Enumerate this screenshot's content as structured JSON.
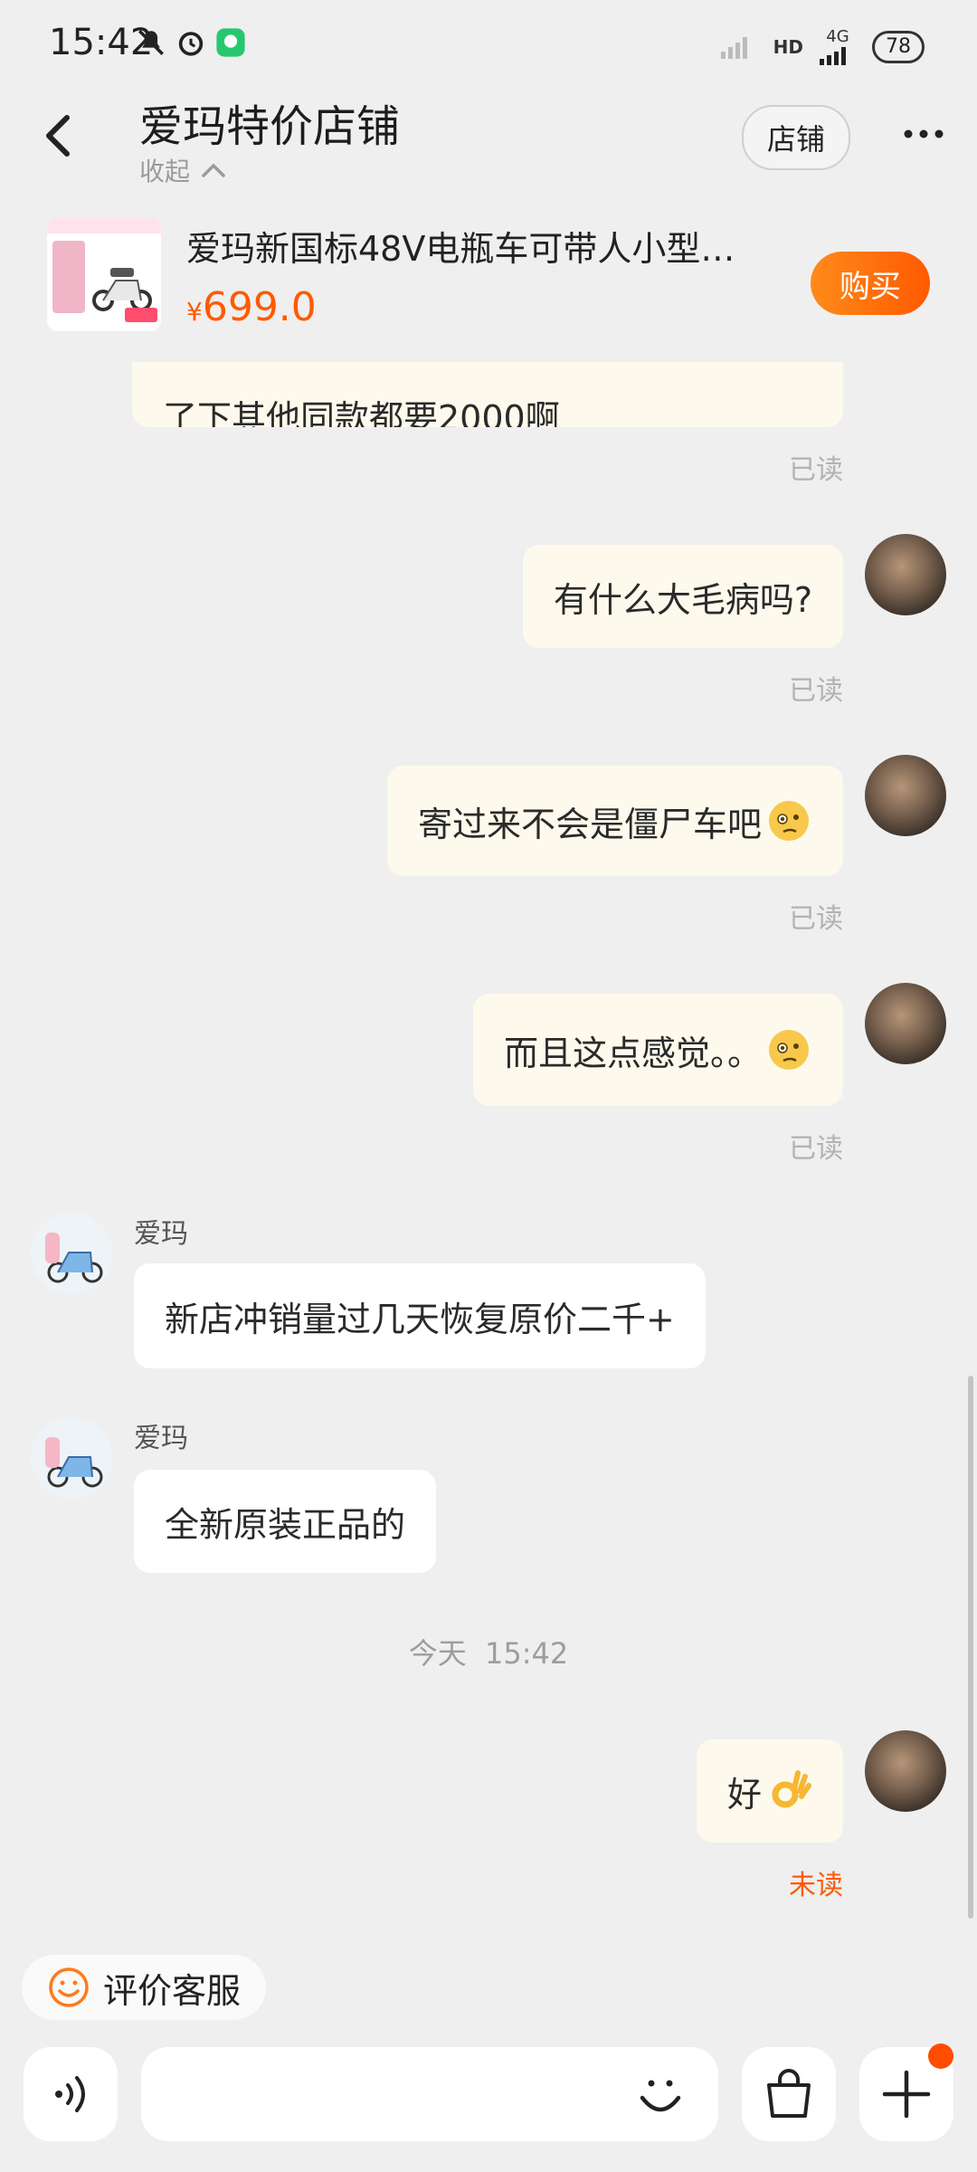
{
  "status_bar": {
    "time": "15:42",
    "network": "4G",
    "hd_label": "HD",
    "battery": "78"
  },
  "header": {
    "title": "爱玛特价店铺",
    "collapse_label": "收起",
    "shop_button": "店铺"
  },
  "product": {
    "name": "爱玛新国标48V电瓶车可带人小型…",
    "price_currency": "¥",
    "price": "699.0",
    "buy_button": "购买"
  },
  "messages": {
    "partial": "了下其他同款都要2000啊",
    "read_label": "已读",
    "m1": "有什么大毛病吗?",
    "m2": "寄过来不会是僵尸车吧",
    "m3": "而且这点感觉。。",
    "shop_name": "爱玛",
    "shop1": "新店冲销量过几天恢复原价二千+",
    "shop2": "全新原装正品的",
    "timestamp": "今天  15:42",
    "m4": "好",
    "unread_label": "未读"
  },
  "footer": {
    "rate_label": "评价客服"
  },
  "colors": {
    "accent": "#ff5a00",
    "my_bubble": "#fdf9ec",
    "shop_bubble": "#ffffff",
    "background": "#efefef"
  }
}
